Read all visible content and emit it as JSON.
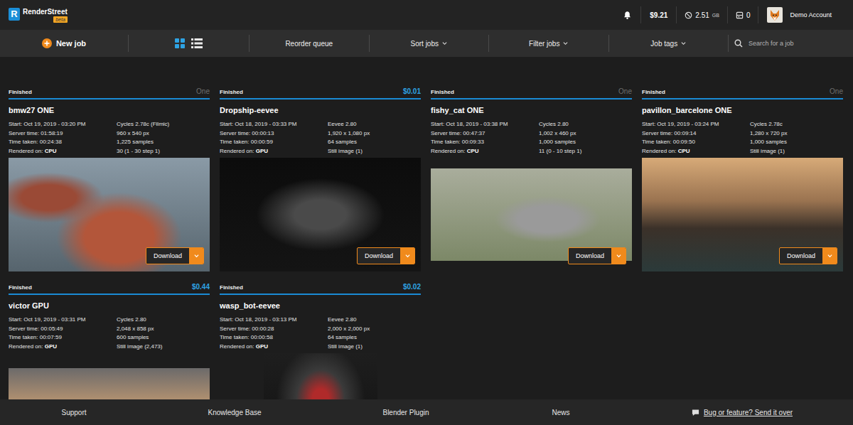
{
  "app": {
    "logo_letter": "R",
    "name": "RenderStreet",
    "badge": "beta"
  },
  "account": {
    "balance": "$9.21",
    "storage": "2.51",
    "storage_unit": "GB",
    "servers": "0",
    "name": "Demo Account"
  },
  "toolbar": {
    "new_job": "New job",
    "views": [
      {
        "kind": "grid",
        "selected": true
      },
      {
        "kind": "list",
        "selected": false
      }
    ],
    "items": [
      {
        "label": "Reorder queue",
        "dropdown": false
      },
      {
        "label": "Sort jobs",
        "dropdown": true
      },
      {
        "label": "Filter jobs",
        "dropdown": true
      },
      {
        "label": "Job tags",
        "dropdown": true
      }
    ],
    "search_placeholder": "Search for a job"
  },
  "jobs": [
    {
      "status": "Finished",
      "price": {
        "text": "One",
        "kind": "plan"
      },
      "title": "bmw27 ONE",
      "details": [
        {
          "label": "Start:",
          "value": "Oct 19, 2019 - 03:20 PM"
        },
        {
          "label": "Server time:",
          "value": "01:58:19"
        },
        {
          "label": "Time taken:",
          "value": "00:24:38"
        },
        {
          "label": "Rendered on:",
          "value": "CPU"
        }
      ],
      "specs": [
        "Cycles 2.78c (Filmic)",
        "960 x 540 px",
        "1,225 samples",
        "30 (1 - 30 step 1)"
      ],
      "download": "Download"
    },
    {
      "status": "Finished",
      "price": {
        "text": "$0.01",
        "kind": "cost"
      },
      "title": "Dropship-eevee",
      "details": [
        {
          "label": "Start:",
          "value": "Oct 18, 2019 - 03:33 PM"
        },
        {
          "label": "Server time:",
          "value": "00:00:13"
        },
        {
          "label": "Time taken:",
          "value": "00:00:59"
        },
        {
          "label": "Rendered on:",
          "value": "GPU"
        }
      ],
      "specs": [
        "Eevee 2.80",
        "1,920 x 1,080 px",
        "64 samples",
        "Still image (1)"
      ],
      "download": "Download"
    },
    {
      "status": "Finished",
      "price": {
        "text": "One",
        "kind": "plan"
      },
      "title": "fishy_cat ONE",
      "details": [
        {
          "label": "Start:",
          "value": "Oct 18, 2019 - 03:38 PM"
        },
        {
          "label": "Server time:",
          "value": "00:47:37"
        },
        {
          "label": "Time taken:",
          "value": "00:09:33"
        },
        {
          "label": "Rendered on:",
          "value": "CPU"
        }
      ],
      "specs": [
        "Cycles 2.80",
        "1,002 x 460 px",
        "1,000 samples",
        "11 (0 - 10 step 1)"
      ],
      "download": "Download"
    },
    {
      "status": "Finished",
      "price": {
        "text": "One",
        "kind": "plan"
      },
      "title": "pavillon_barcelone ONE",
      "details": [
        {
          "label": "Start:",
          "value": "Oct 19, 2019 - 03:24 PM"
        },
        {
          "label": "Server time:",
          "value": "00:09:14"
        },
        {
          "label": "Time taken:",
          "value": "00:09:50"
        },
        {
          "label": "Rendered on:",
          "value": "CPU"
        }
      ],
      "specs": [
        "Cycles 2.78c",
        "1,280 x 720 px",
        "1,000 samples",
        "Still image (1)"
      ],
      "download": "Download"
    },
    {
      "status": "Finished",
      "price": {
        "text": "$0.44",
        "kind": "cost"
      },
      "title": "victor GPU",
      "details": [
        {
          "label": "Start:",
          "value": "Oct 19, 2019 - 03:31 PM"
        },
        {
          "label": "Server time:",
          "value": "00:05:49"
        },
        {
          "label": "Time taken:",
          "value": "00:07:59"
        },
        {
          "label": "Rendered on:",
          "value": "GPU"
        }
      ],
      "specs": [
        "Cycles 2.80",
        "2,048 x 858 px",
        "600 samples",
        "Still image (2,473)"
      ]
    },
    {
      "status": "Finished",
      "price": {
        "text": "$0.02",
        "kind": "cost"
      },
      "title": "wasp_bot-eevee",
      "details": [
        {
          "label": "Start:",
          "value": "Oct 18, 2019 - 03:13 PM"
        },
        {
          "label": "Server time:",
          "value": "00:00:28"
        },
        {
          "label": "Time taken:",
          "value": "00:00:58"
        },
        {
          "label": "Rendered on:",
          "value": "GPU"
        }
      ],
      "specs": [
        "Eevee 2.80",
        "2,000 x 2,000 px",
        "64 samples",
        "Still image (1)"
      ]
    }
  ],
  "footer": {
    "links": [
      "Support",
      "Knowledge Base",
      "Blender Plugin",
      "News"
    ],
    "feedback": "Bug or feature? Send it over"
  }
}
